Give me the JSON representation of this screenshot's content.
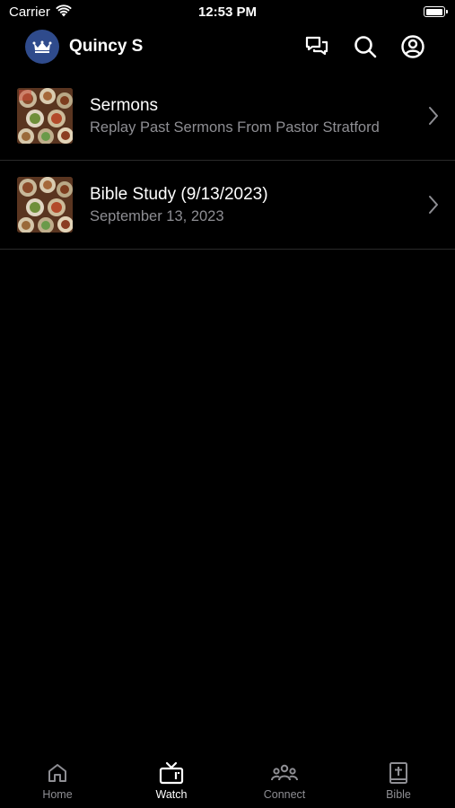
{
  "status_bar": {
    "carrier": "Carrier",
    "time": "12:53 PM"
  },
  "header": {
    "title": "Quincy S"
  },
  "list": [
    {
      "title": "Sermons",
      "subtitle": "Replay Past Sermons From Pastor Stratford"
    },
    {
      "title": "Bible Study (9/13/2023)",
      "subtitle": "September 13, 2023"
    }
  ],
  "tabs": [
    {
      "label": "Home",
      "icon": "home-icon",
      "active": false
    },
    {
      "label": "Watch",
      "icon": "tv-icon",
      "active": true
    },
    {
      "label": "Connect",
      "icon": "people-icon",
      "active": false
    },
    {
      "label": "Bible",
      "icon": "bible-icon",
      "active": false
    }
  ],
  "colors": {
    "background": "#000000",
    "avatar": "#2f4b8c",
    "secondary_text": "#8e8e93",
    "divider": "#2a2a2a"
  }
}
